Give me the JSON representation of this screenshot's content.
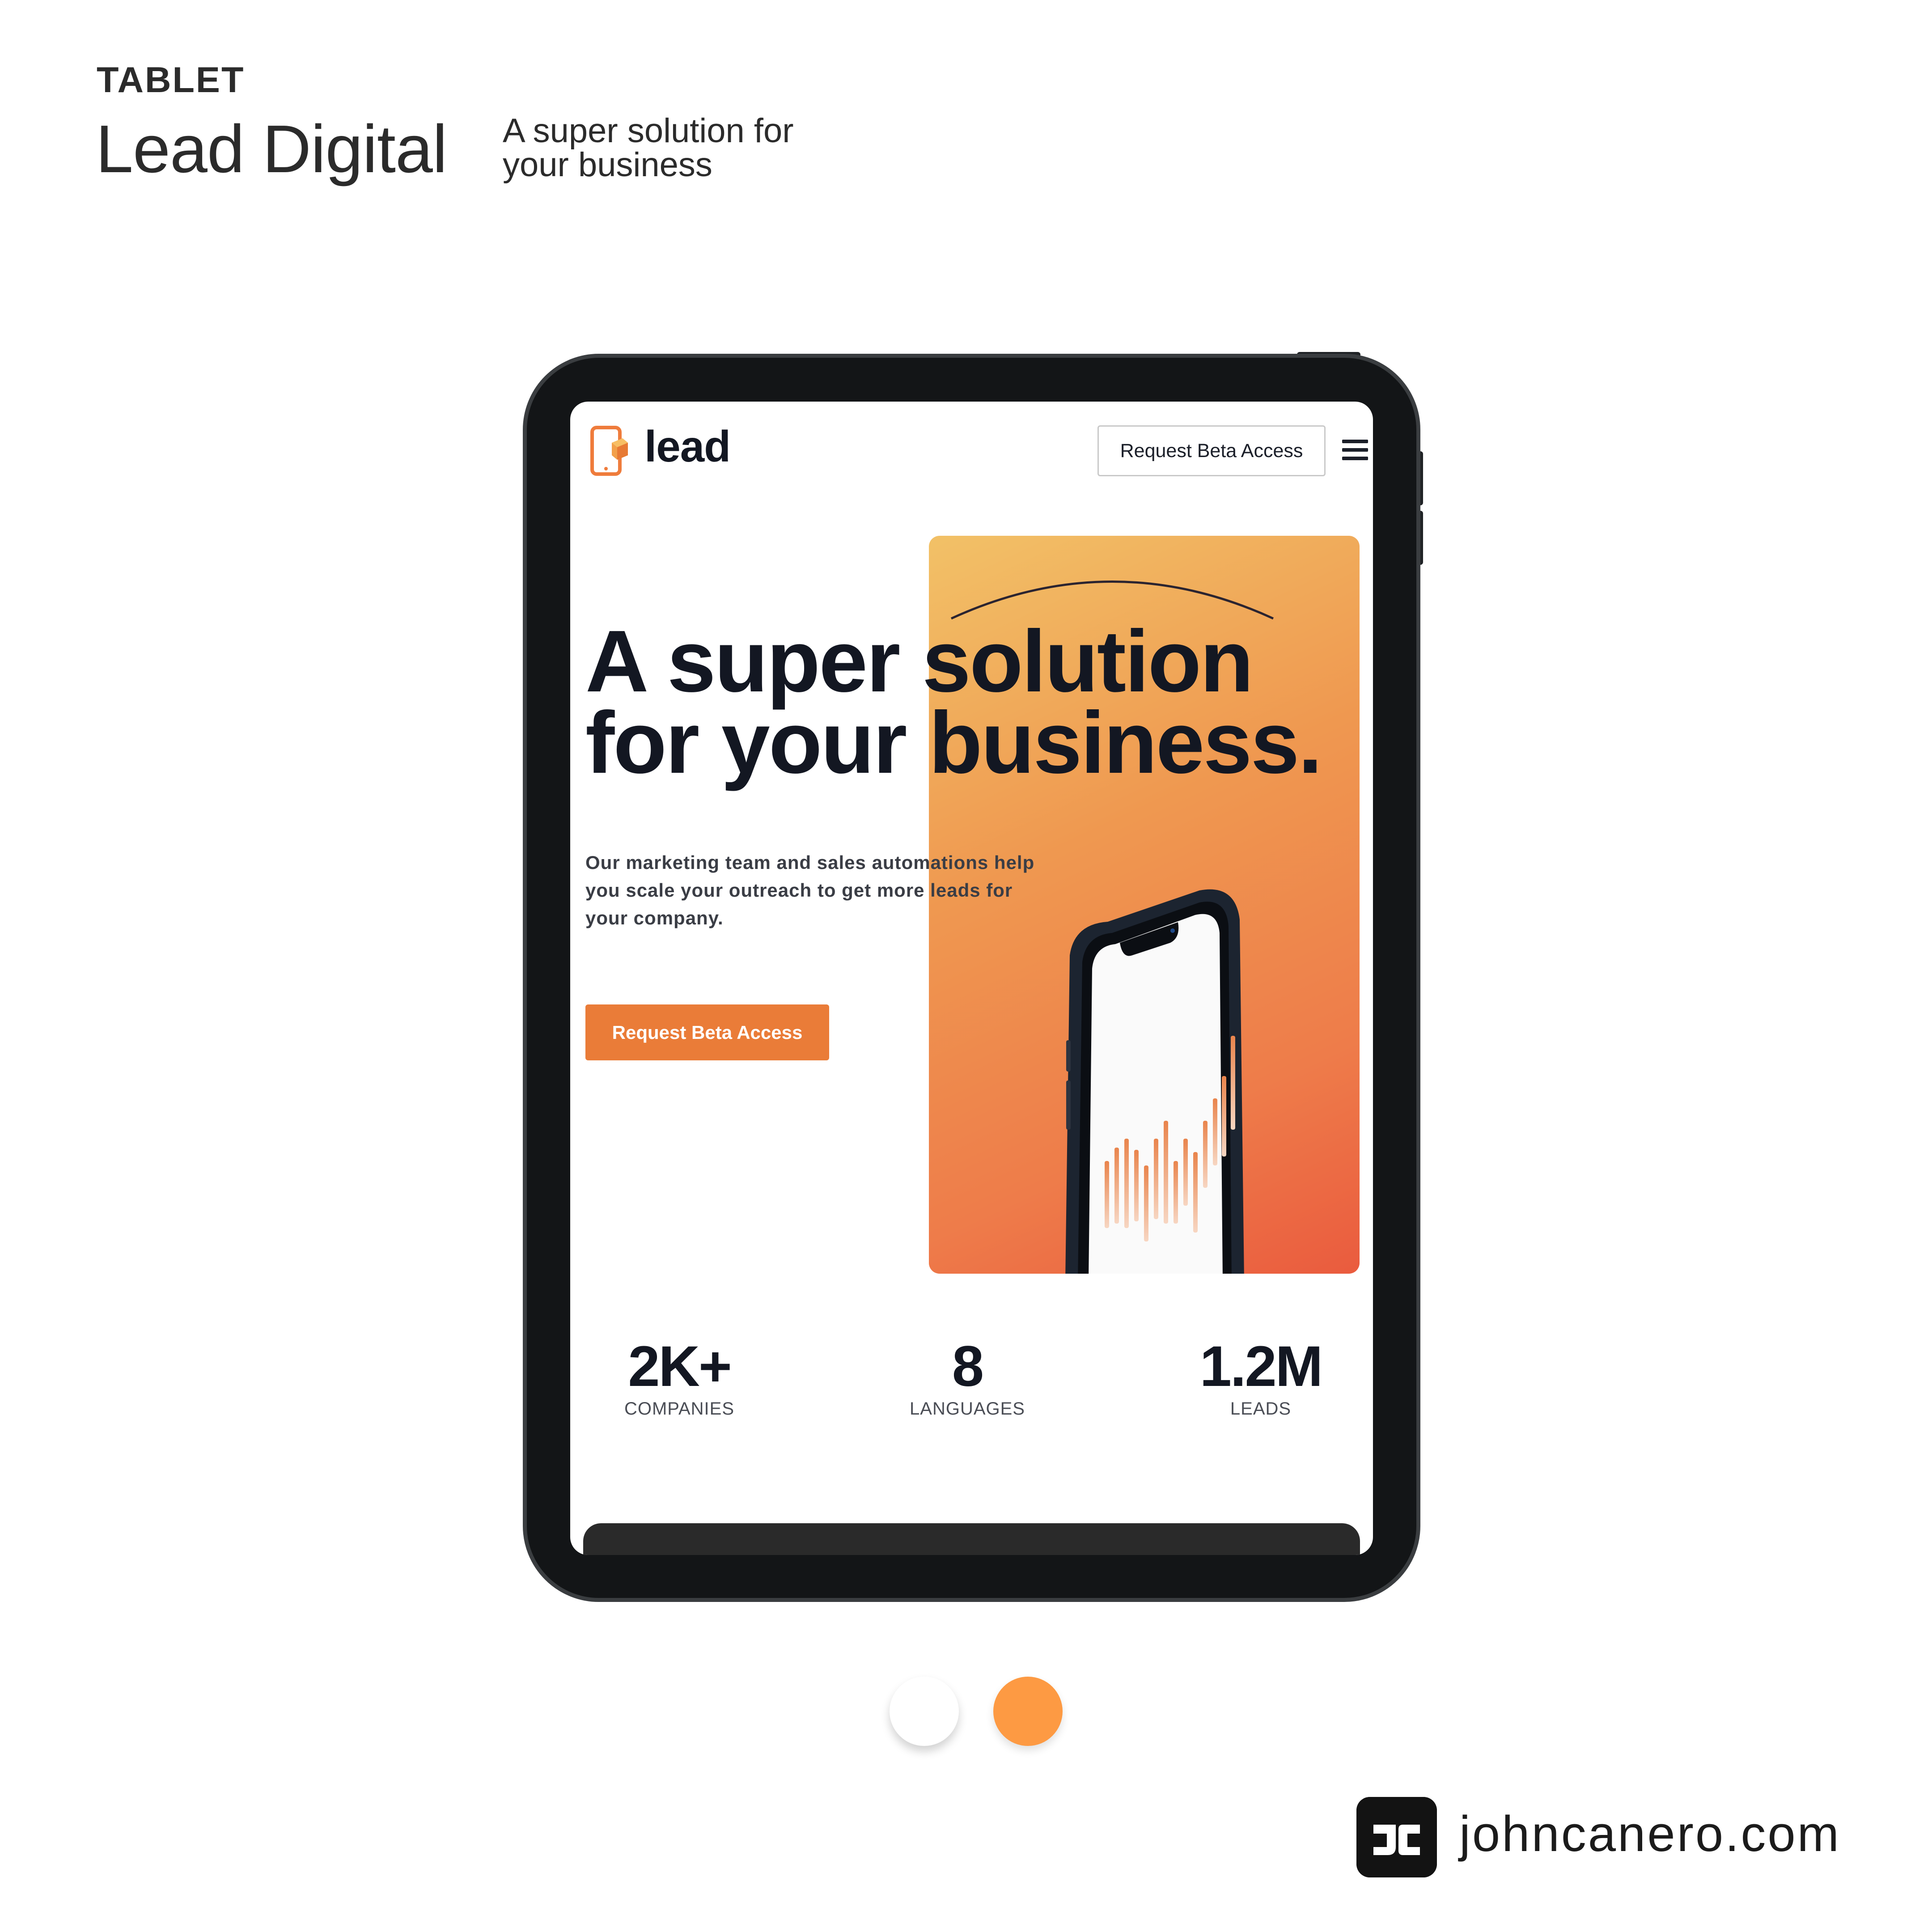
{
  "header": {
    "device_label": "TABLET",
    "project_title": "Lead Digital",
    "project_tagline": "A super solution for your business"
  },
  "screen": {
    "navbar": {
      "brand": "lead",
      "cta_label": "Request Beta Access",
      "menu_icon": "hamburger-menu-icon"
    },
    "hero": {
      "title": "A super solution for your business.",
      "body": "Our marketing team and sales automations help you scale your outreach to get more leads for your company.",
      "cta_label": "Request Beta Access",
      "gradient_colors": [
        "#f2c167",
        "#ef9850",
        "#ea5b3e"
      ]
    },
    "stats": [
      {
        "value": "2K+",
        "label": "COMPANIES"
      },
      {
        "value": "8",
        "label": "LANGUAGES"
      },
      {
        "value": "1.2M",
        "label": "LEADS"
      }
    ]
  },
  "pagination": {
    "total": 2,
    "active_index": 1,
    "active_color": "#fd9a43"
  },
  "footer": {
    "site": "johncanero.com"
  },
  "colors": {
    "accent": "#ea7c38",
    "text_dark": "#131722",
    "frame": "#131517"
  }
}
